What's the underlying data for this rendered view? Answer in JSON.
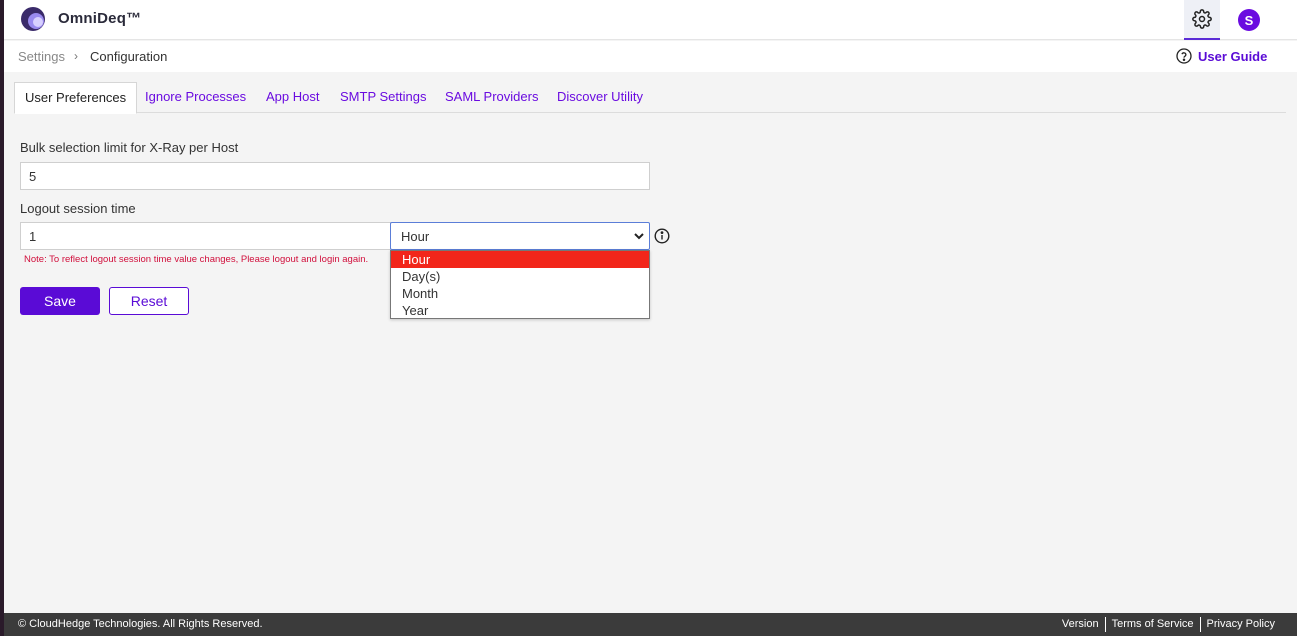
{
  "app": {
    "brand": "OmniDeq™",
    "avatar_initial": "S"
  },
  "breadcrumb": {
    "root": "Settings",
    "separator": "›",
    "current": "Configuration"
  },
  "help": {
    "label": "User Guide"
  },
  "tabs": [
    {
      "label": "User Preferences",
      "active": true
    },
    {
      "label": "Ignore Processes",
      "active": false
    },
    {
      "label": "App Host",
      "active": false
    },
    {
      "label": "SMTP Settings",
      "active": false
    },
    {
      "label": "SAML Providers",
      "active": false
    },
    {
      "label": "Discover Utility",
      "active": false
    }
  ],
  "form": {
    "bulk_label": "Bulk selection limit for X-Ray per Host",
    "bulk_value": "5",
    "logout_label": "Logout session time",
    "logout_value": "1",
    "unit_selected": "Hour",
    "unit_options": [
      "Hour",
      "Day(s)",
      "Month",
      "Year"
    ],
    "note": "Note: To reflect logout session time value changes, Please logout and login again.",
    "save_label": "Save",
    "reset_label": "Reset"
  },
  "footer": {
    "copyright": "© CloudHedge Technologies. All Rights Reserved.",
    "links": [
      "Version",
      "Terms of Service",
      "Privacy Policy"
    ]
  },
  "colors": {
    "accent": "#5a0bd6",
    "highlight": "#f2261a",
    "note": "#d10f3c",
    "footer_bg": "#3b3b3b"
  }
}
